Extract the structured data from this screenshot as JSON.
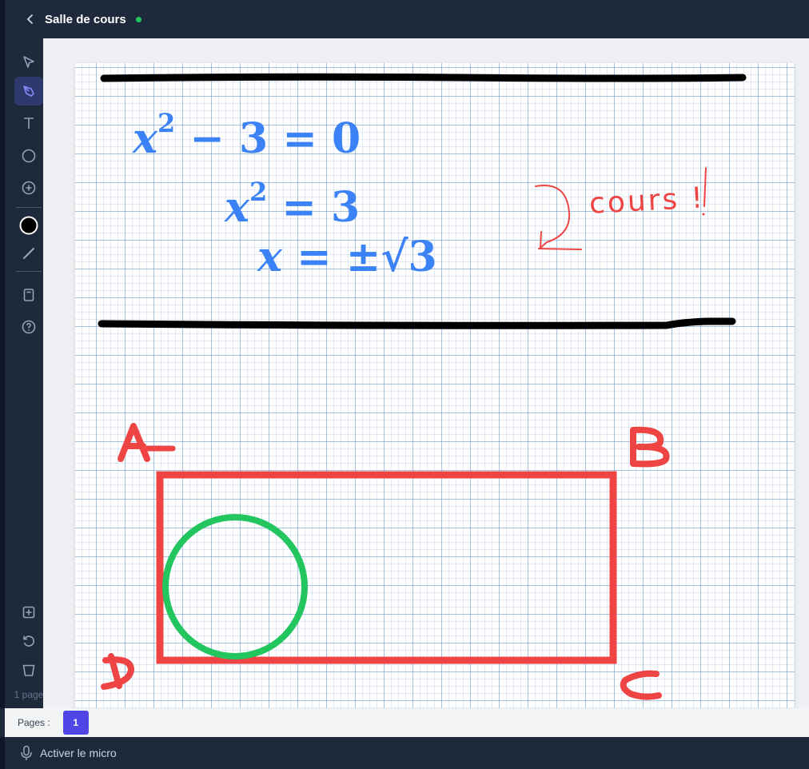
{
  "header": {
    "title": "Salle de cours",
    "status_color": "#22c55e"
  },
  "toolbar": {
    "tools": [
      "select-icon",
      "pen-icon",
      "text-icon",
      "circle-icon",
      "add-shape-icon",
      "color-picker",
      "line-icon",
      "document-icon",
      "help-icon"
    ],
    "active_tool": "pen-icon",
    "current_color": "#000000",
    "bottom_tools": [
      "add-page-icon",
      "undo-icon",
      "trash-icon"
    ],
    "page_count_label": "1 page"
  },
  "canvas": {
    "math": {
      "line1": {
        "base": "x",
        "exp": "2",
        "rest": " − 3 = 0"
      },
      "line2": {
        "base": "x",
        "exp": "2",
        "rest": " = 3"
      },
      "line3": {
        "base": "x",
        "rest": " = ±√3"
      }
    },
    "note": "cours !",
    "labels": {
      "a": "A",
      "b": "B",
      "c": "C",
      "d": "D"
    },
    "colors": {
      "math": "#3b82f6",
      "annotation": "#ef4444",
      "circle": "#22c55e",
      "lines": "#000000"
    }
  },
  "pagination": {
    "label": "Pages :",
    "current_page": "1"
  },
  "footer": {
    "mic_label": "Activer le micro"
  }
}
